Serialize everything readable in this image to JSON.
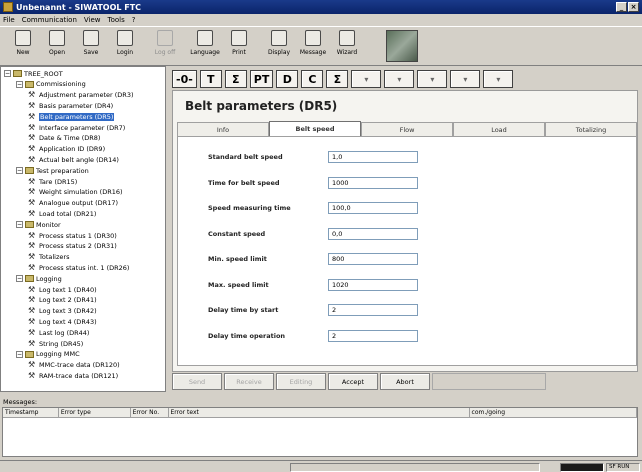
{
  "window": {
    "title": "Unbenannt - SIWATOOL FTC"
  },
  "menu": [
    "File",
    "Communication",
    "View",
    "Tools",
    "?"
  ],
  "toolbar": [
    {
      "label": "New",
      "icon": "new-file-icon",
      "enabled": true
    },
    {
      "label": "Open",
      "icon": "open-folder-icon",
      "enabled": true
    },
    {
      "label": "Save",
      "icon": "save-icon",
      "enabled": true
    },
    {
      "label": "Login",
      "icon": "login-icon",
      "enabled": true
    },
    {
      "label": "Log off",
      "icon": "logoff-icon",
      "enabled": false
    },
    {
      "label": "Language",
      "icon": "language-icon",
      "enabled": true
    },
    {
      "label": "Print",
      "icon": "print-icon",
      "enabled": true
    },
    {
      "label": "Display",
      "icon": "display-icon",
      "enabled": true
    },
    {
      "label": "Message",
      "icon": "message-icon",
      "enabled": true
    },
    {
      "label": "Wizard",
      "icon": "wizard-icon",
      "enabled": true
    }
  ],
  "tree": [
    {
      "label": "TREE_ROOT",
      "level": 0,
      "type": "root"
    },
    {
      "label": "Commissioning",
      "level": 1,
      "type": "folder"
    },
    {
      "label": "Adjustment parameter (DR3)",
      "level": 2,
      "type": "leaf"
    },
    {
      "label": "Basis parameter (DR4)",
      "level": 2,
      "type": "leaf"
    },
    {
      "label": "Belt parameters (DR5)",
      "level": 2,
      "type": "leaf",
      "selected": true
    },
    {
      "label": "Interface parameter (DR7)",
      "level": 2,
      "type": "leaf"
    },
    {
      "label": "Date & Time (DR8)",
      "level": 2,
      "type": "leaf"
    },
    {
      "label": "Application ID (DR9)",
      "level": 2,
      "type": "leaf"
    },
    {
      "label": "Actual belt angle (DR14)",
      "level": 2,
      "type": "leaf"
    },
    {
      "label": "Test preparation",
      "level": 1,
      "type": "folder"
    },
    {
      "label": "Tare (DR15)",
      "level": 2,
      "type": "leaf"
    },
    {
      "label": "Weight simulation (DR16)",
      "level": 2,
      "type": "leaf"
    },
    {
      "label": "Analogue output (DR17)",
      "level": 2,
      "type": "leaf"
    },
    {
      "label": "Load total (DR21)",
      "level": 2,
      "type": "leaf"
    },
    {
      "label": "Monitor",
      "level": 1,
      "type": "folder"
    },
    {
      "label": "Process status 1 (DR30)",
      "level": 2,
      "type": "leaf"
    },
    {
      "label": "Process status 2 (DR31)",
      "level": 2,
      "type": "leaf"
    },
    {
      "label": "Totalizers",
      "level": 2,
      "type": "leaf"
    },
    {
      "label": "Process status int. 1 (DR26)",
      "level": 2,
      "type": "leaf"
    },
    {
      "label": "Logging",
      "level": 1,
      "type": "folder"
    },
    {
      "label": "Log text 1 (DR40)",
      "level": 2,
      "type": "leaf"
    },
    {
      "label": "Log text 2 (DR41)",
      "level": 2,
      "type": "leaf"
    },
    {
      "label": "Log text 3 (DR42)",
      "level": 2,
      "type": "leaf"
    },
    {
      "label": "Log text 4 (DR43)",
      "level": 2,
      "type": "leaf"
    },
    {
      "label": "Last log (DR44)",
      "level": 2,
      "type": "leaf"
    },
    {
      "label": "String (DR45)",
      "level": 2,
      "type": "leaf"
    },
    {
      "label": "Logging MMC",
      "level": 1,
      "type": "folder"
    },
    {
      "label": "MMC-trace data (DR120)",
      "level": 2,
      "type": "leaf"
    },
    {
      "label": "RAM-trace data (DR121)",
      "level": 2,
      "type": "leaf"
    }
  ],
  "func_buttons": [
    "-0-",
    "T",
    "Σ",
    "PT",
    "D",
    "C",
    "Σ"
  ],
  "page": {
    "title": "Belt parameters (DR5)",
    "tabs": [
      "Info",
      "Belt speed",
      "Flow",
      "Load",
      "Totalizing"
    ],
    "active_tab": 1,
    "fields": [
      {
        "label": "Standard belt speed",
        "value": "1,0"
      },
      {
        "label": "Time for belt speed",
        "value": "1000"
      },
      {
        "label": "Speed measuring time",
        "value": "100,0"
      },
      {
        "label": "Constant speed",
        "value": "0,0"
      },
      {
        "label": "Min. speed limit",
        "value": "800"
      },
      {
        "label": "Max. speed limit",
        "value": "1020"
      },
      {
        "label": "Delay time by start",
        "value": "2"
      },
      {
        "label": "Delay time operation",
        "value": "2"
      }
    ]
  },
  "bottom_buttons": [
    {
      "label": "Send",
      "enabled": false
    },
    {
      "label": "Receive",
      "enabled": false
    },
    {
      "label": "Editing",
      "enabled": false
    },
    {
      "label": "Accept",
      "enabled": true
    },
    {
      "label": "Abort",
      "enabled": true
    }
  ],
  "messages": {
    "title": "Messages:",
    "columns": [
      "Timestamp",
      "Error type",
      "Error No.",
      "Error text",
      "com./going"
    ]
  },
  "status": {
    "right": "SF RUN"
  }
}
